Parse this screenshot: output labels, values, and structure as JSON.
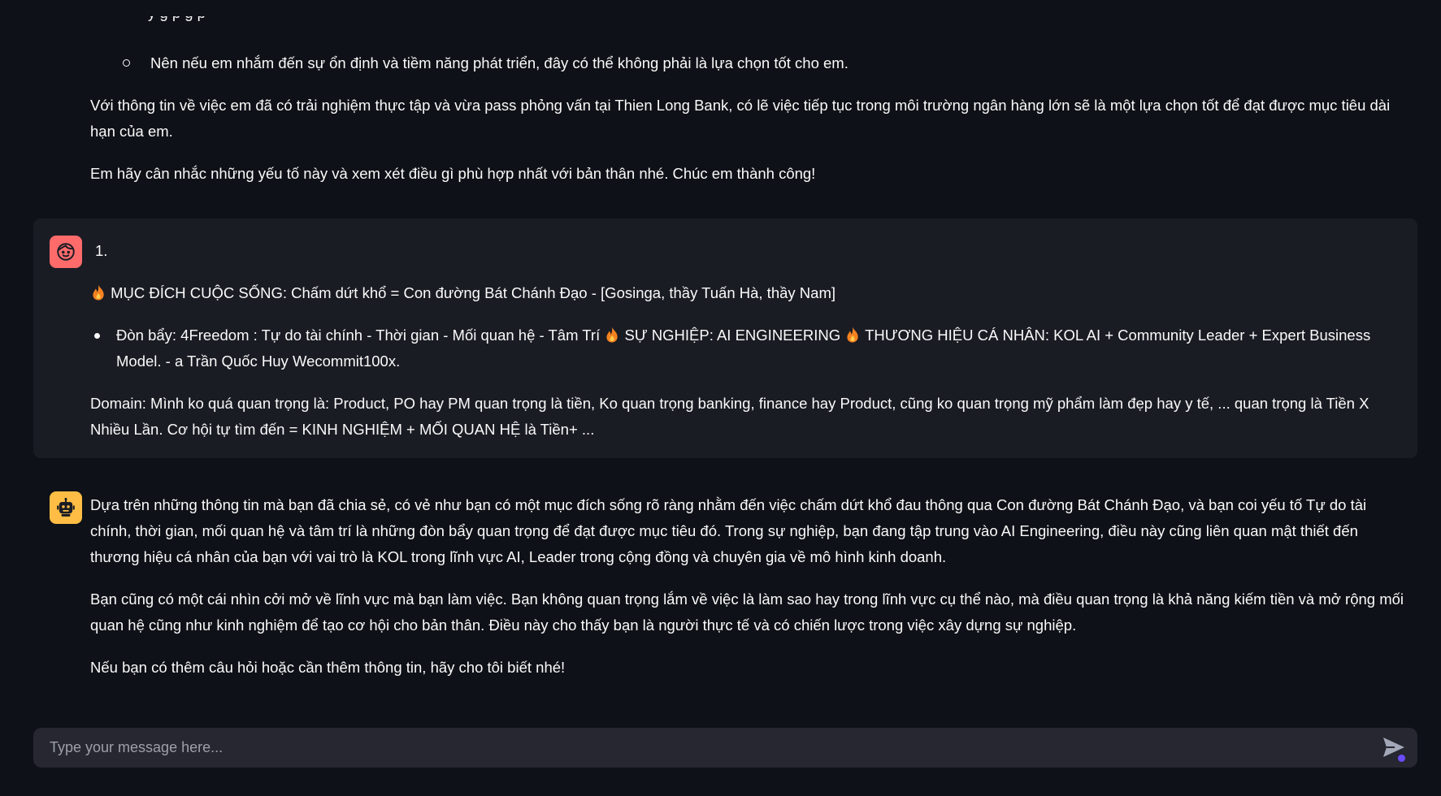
{
  "colors": {
    "background": "#0e1117",
    "user_card": "#1a1c24",
    "user_avatar": "#ff6b6b",
    "bot_avatar": "#ffbd45",
    "input_bg": "#262730",
    "fire_icon": "#f58220",
    "status_dot": "#6c4cff"
  },
  "icons": {
    "user_avatar": "smiley-face-icon",
    "bot_avatar": "robot-icon",
    "fire": "fire-icon",
    "send": "send-icon"
  },
  "previous_reply": {
    "partial_line": "y                                     g                         p      g    p",
    "bullet": "Nên nếu em nhắm đến sự ổn định và tiềm năng phát triển, đây có thể không phải là lựa chọn tốt cho em.",
    "para1": "Với thông tin về việc em đã có trải nghiệm thực tập và vừa pass phỏng vấn tại Thien Long Bank, có lẽ việc tiếp tục trong môi trường ngân hàng lớn sẽ là một lựa chọn tốt để đạt được mục tiêu dài hạn của em.",
    "para2": "Em hãy cân nhắc những yếu tố này và xem xét điều gì phù hợp nhất với bản thân nhé. Chúc em thành công!"
  },
  "user_message": {
    "number": "1.",
    "purpose": "MỤC ĐÍCH CUỘC SỐNG: Chấm dứt khổ = Con đường Bát Chánh Đạo - [Gosinga, thầy Tuấn Hà, thầy Nam]",
    "bullet_part1": "Đòn bẩy: 4Freedom : Tự do tài chính - Thời gian - Mối quan hệ - Tâm Trí",
    "bullet_part2": "SỰ NGHIỆP: AI ENGINEERING",
    "bullet_part3": "THƯƠNG HIỆU CÁ NHÂN: KOL AI + Community Leader + Expert Business Model. - a Trần Quốc Huy Wecommit100x.",
    "domain": "Domain: Mình ko quá quan trọng là: Product, PO hay PM quan trọng là tiền, Ko quan trọng banking, finance hay Product, cũng ko quan trọng mỹ phẩm làm đẹp hay y tế, ... quan trọng là Tiền X Nhiều Lần. Cơ hội tự tìm đến = KINH NGHIỆM + MỐI QUAN HỆ là Tiền+ ..."
  },
  "bot_reply": {
    "para1": "Dựa trên những thông tin mà bạn đã chia sẻ, có vẻ như bạn có một mục đích sống rõ ràng nhằm đến việc chấm dứt khổ đau thông qua Con đường Bát Chánh Đạo, và bạn coi yếu tố Tự do tài chính, thời gian, mối quan hệ và tâm trí là những đòn bẩy quan trọng để đạt được mục tiêu đó. Trong sự nghiệp, bạn đang tập trung vào AI Engineering, điều này cũng liên quan mật thiết đến thương hiệu cá nhân của bạn với vai trò là KOL trong lĩnh vực AI, Leader trong cộng đồng và chuyên gia về mô hình kinh doanh.",
    "para2": "Bạn cũng có một cái nhìn cởi mở về lĩnh vực mà bạn làm việc. Bạn không quan trọng lắm về việc là làm sao hay trong lĩnh vực cụ thể nào, mà điều quan trọng là khả năng kiếm tiền và mở rộng mối quan hệ cũng như kinh nghiệm để tạo cơ hội cho bản thân. Điều này cho thấy bạn là người thực tế và có chiến lược trong việc xây dựng sự nghiệp.",
    "para3": "Nếu bạn có thêm câu hỏi hoặc cần thêm thông tin, hãy cho tôi biết nhé!"
  },
  "chat_input": {
    "placeholder": "Type your message here...",
    "value": ""
  }
}
